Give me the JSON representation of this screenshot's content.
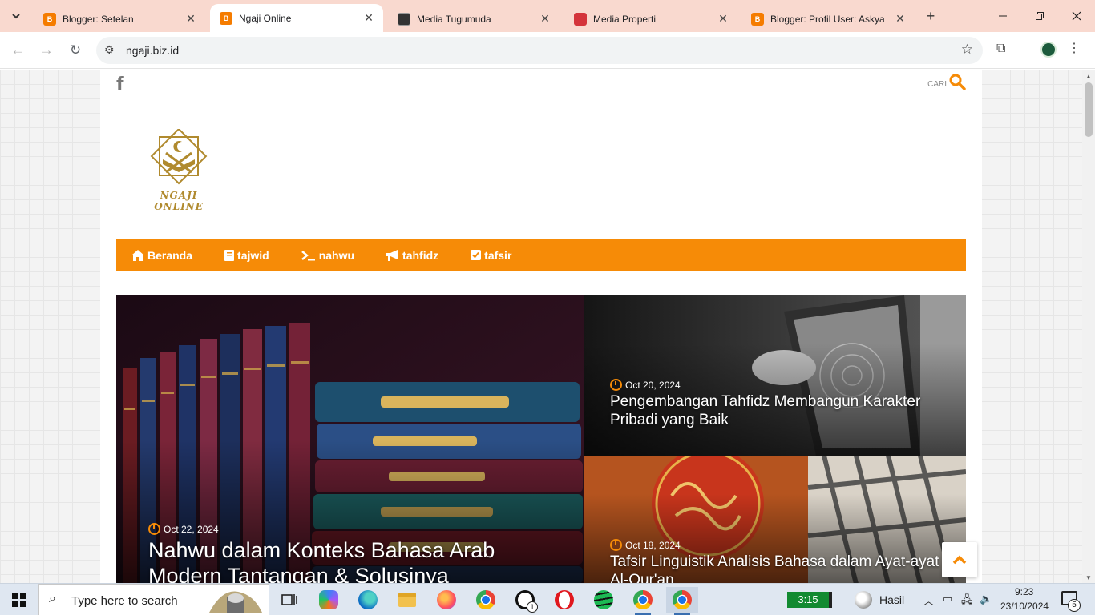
{
  "browser": {
    "tabs": [
      {
        "title": "Blogger: Setelan",
        "favicon": "blogger-icon",
        "active": false
      },
      {
        "title": "Ngaji Online",
        "favicon": "blogger-icon",
        "active": true
      },
      {
        "title": "Media Tugumuda",
        "favicon": "site-icon",
        "active": false
      },
      {
        "title": "Media Properti",
        "favicon": "site-icon",
        "active": false
      },
      {
        "title": "Blogger: Profil User: Askya",
        "favicon": "blogger-icon",
        "active": false
      }
    ],
    "url": "ngaji.biz.id",
    "colors": {
      "tabstrip": "#f9d9cf",
      "blogger": "#f57c00"
    }
  },
  "site": {
    "search_label": "CARI",
    "logo_text": "NGAJI ONLINE",
    "menu": [
      {
        "label": "Beranda",
        "icon": "home-icon"
      },
      {
        "label": "tajwid",
        "icon": "book-icon"
      },
      {
        "label": "nahwu",
        "icon": "terminal-icon"
      },
      {
        "label": "tahfidz",
        "icon": "bullhorn-icon"
      },
      {
        "label": "tafsir",
        "icon": "check-square-icon"
      }
    ],
    "accent_color": "#f68b07",
    "posts": [
      {
        "date": "Oct 22, 2024",
        "title": "Nahwu dalam Konteks Bahasa Arab Modern Tantangan & Solusinya"
      },
      {
        "date": "Oct 20, 2024",
        "title": "Pengembangan Tahfidz Membangun Karakter Pribadi yang Baik"
      },
      {
        "date": "Oct 18, 2024",
        "title": "Tafsir Linguistik Analisis Bahasa dalam Ayat-ayat Al-Qur'an"
      }
    ]
  },
  "taskbar": {
    "search_placeholder": "Type here to search",
    "battery_time": "3:15",
    "weather": "Hasil",
    "time": "9:23",
    "date": "23/10/2024",
    "notification_count": "5",
    "apps": [
      "task-view",
      "copilot",
      "edge",
      "file-explorer",
      "firefox",
      "chrome",
      "whatsapp",
      "opera",
      "spotify",
      "chrome-profile-n",
      "chrome-active"
    ],
    "whatsapp_badge": "1"
  }
}
